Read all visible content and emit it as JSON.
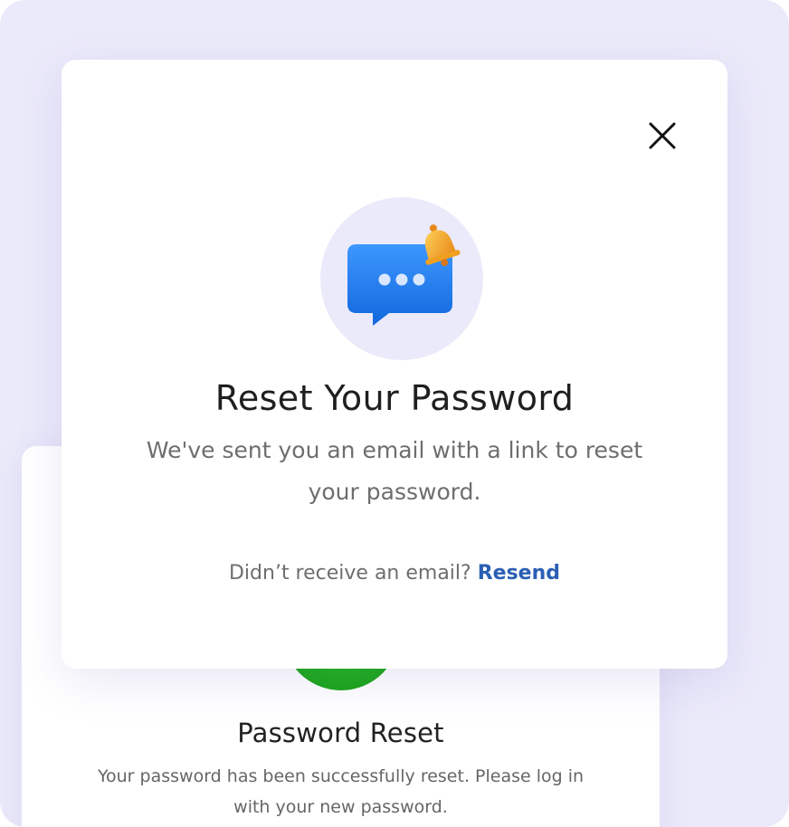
{
  "modal": {
    "close_label": "close",
    "title": "Reset Your Password",
    "message": "We've sent you an email with a link to reset your password.",
    "resend_prompt": "Didn’t receive an email?",
    "resend_link": "Resend"
  },
  "back_card": {
    "title": "Password Reset",
    "message": "Your password has been successfully reset. Please log in with your new password."
  },
  "icons": {
    "close": "close-icon",
    "hero": "chat-bubble-bell-icon",
    "success": "success-check-icon"
  },
  "colors": {
    "background": "#ebeafa",
    "accent_link": "#2b5fb4",
    "bubble_blue": "#1e7ef2",
    "bell_orange": "#f4a51a",
    "success_green": "#1fb21c"
  }
}
